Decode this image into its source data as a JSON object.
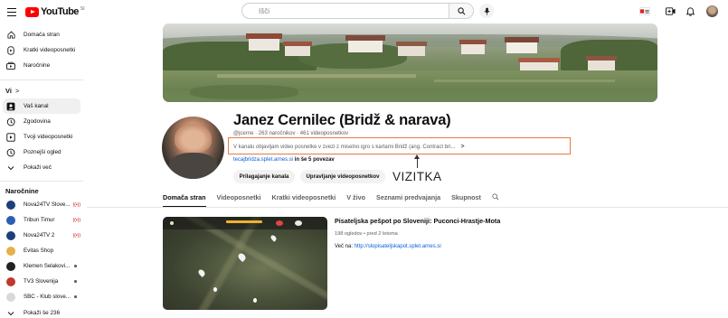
{
  "header": {
    "logo_text": "YouTube",
    "logo_region": "SI",
    "search_placeholder": "Išči"
  },
  "sidebar": {
    "main": [
      {
        "label": "Domača stran",
        "icon": "home-icon"
      },
      {
        "label": "Kratki videoposnetki",
        "icon": "shorts-icon"
      },
      {
        "label": "Naročnine",
        "icon": "subscriptions-icon"
      }
    ],
    "you_heading": "Vi",
    "you_chevron": ">",
    "you_items": [
      {
        "label": "Vaš kanal",
        "icon": "your-channel-icon"
      },
      {
        "label": "Zgodovina",
        "icon": "history-icon"
      },
      {
        "label": "Tvoji videoposnetki",
        "icon": "your-videos-icon"
      },
      {
        "label": "Poznejši ogled",
        "icon": "watch-later-icon"
      },
      {
        "label": "Pokaži več",
        "icon": "chevron-down-icon"
      }
    ],
    "subs_heading": "Naročnine",
    "subs": [
      {
        "label": "Nova24TV Slove...",
        "badge": "live",
        "avatar_color": "#1d3f7a"
      },
      {
        "label": "Tribun Timur",
        "badge": "live",
        "avatar_color": "#2b5fb5"
      },
      {
        "label": "Nova24TV 2",
        "badge": "live",
        "avatar_color": "#1d3f7a"
      },
      {
        "label": "Evitas Shop",
        "badge": "",
        "avatar_color": "#e6b04a"
      },
      {
        "label": "Klemen Selakovi...",
        "badge": "dot",
        "avatar_color": "#222222"
      },
      {
        "label": "TV3 Slovenija",
        "badge": "dot",
        "avatar_color": "#c0392b"
      },
      {
        "label": "SBC - Klub slove...",
        "badge": "dot",
        "avatar_color": "#d9d9d9"
      }
    ],
    "show_more_label": "Pokaži še 236"
  },
  "channel": {
    "title": "Janez Cernilec (Bridž & narava)",
    "meta": "@jcerne · 263 naročnikov · 461 videoposnetkov",
    "description": "V kanalu objavljam video posnetke v zvezi z miselno igro s kartami Bridž (ang. Contract bri...",
    "description_chevron": ">",
    "link_text": "tecajbridza.splet.arnes.si",
    "link_more": "in še 5 povezav",
    "customize_button": "Prilagajanje kanala",
    "manage_button": "Upravljanje videoposnetkov",
    "annotation": "VIZITKA"
  },
  "tabs": [
    "Domača stran",
    "Videoposnetki",
    "Kratki videoposnetki",
    "V živo",
    "Seznami predvajanja",
    "Skupnost"
  ],
  "active_tab": "Domača stran",
  "featured": {
    "title": "Pisateljska peš­pot po Sloveniji: Puconci-Hrastje-Mota",
    "meta": "198 ogledov • pred 2 letoma",
    "desc_prefix": "Več na:",
    "desc_link": "http://slopisateljskapot.splet.arnes.si"
  },
  "colors": {
    "brand_red": "#ff0000",
    "annotation_box": "#e87a3e",
    "link": "#065fd4"
  }
}
